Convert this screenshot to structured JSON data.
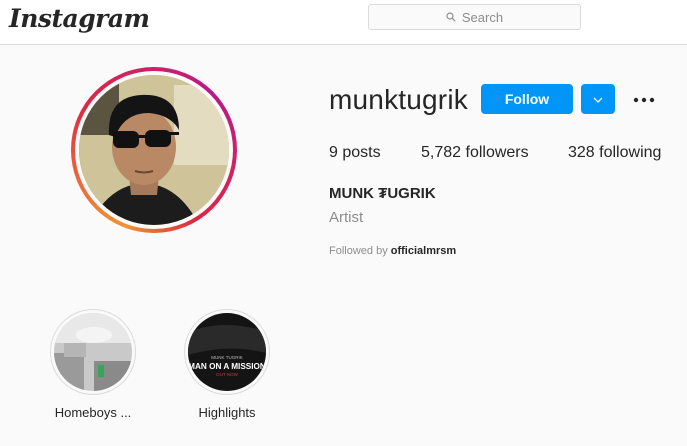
{
  "topbar": {
    "logo": "Instagram",
    "search_placeholder": "Search"
  },
  "profile": {
    "username": "munktugrik",
    "follow_label": "Follow",
    "stats": {
      "posts_count": "9",
      "posts_label": "posts",
      "followers_count": "5,782",
      "followers_label": "followers",
      "following_count": "328",
      "following_label": "following"
    },
    "full_name": "MUNK ₮UGRIK",
    "category": "Artist",
    "followed_by_prefix": "Followed by",
    "followed_by_user": "officialmrsm"
  },
  "highlights": [
    {
      "label": "Homeboys ..."
    },
    {
      "label": "Highlights",
      "cover_small_text": "MUNK TUGRIK",
      "cover_title": "MAN ON A MISSION",
      "cover_sub": "OUT NOW"
    }
  ],
  "colors": {
    "accent": "#0095f6",
    "background": "#fafafa",
    "text": "#262626",
    "muted": "#8e8e8e",
    "border": "#dbdbdb"
  },
  "icons": [
    "search-icon",
    "chevron-down-icon",
    "more-options-icon"
  ]
}
